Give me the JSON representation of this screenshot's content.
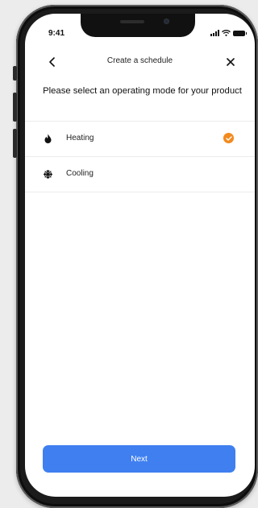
{
  "status_bar": {
    "time": "9:41"
  },
  "header": {
    "title": "Create a schedule"
  },
  "prompt": "Please select an operating mode for your product",
  "options": [
    {
      "label": "Heating",
      "icon": "flame-icon",
      "selected": true
    },
    {
      "label": "Cooling",
      "icon": "snowflake-icon",
      "selected": false
    }
  ],
  "footer": {
    "next_label": "Next"
  },
  "colors": {
    "accent": "#3f7ff0",
    "selected": "#f28a1e"
  }
}
